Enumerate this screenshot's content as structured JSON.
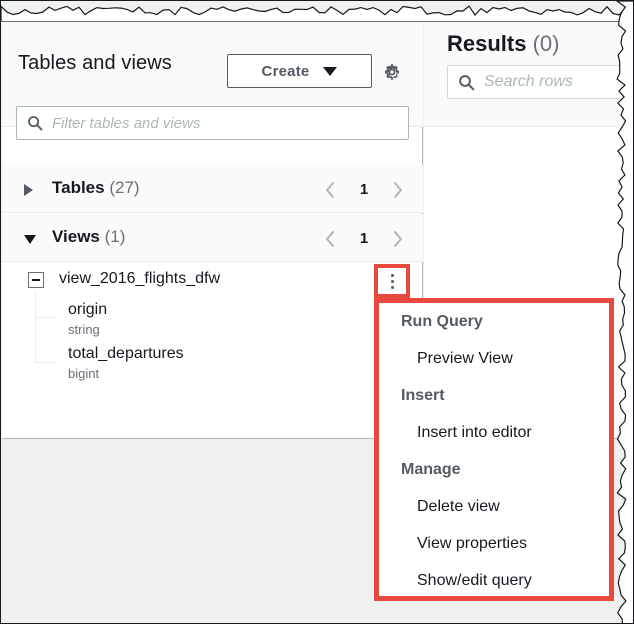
{
  "left_panel": {
    "title": "Tables and views",
    "create_button": {
      "label": "Create",
      "caret_icon": "caret-down-icon"
    },
    "settings_icon": "gear-icon",
    "filter": {
      "placeholder": "Filter tables and views",
      "value": "",
      "icon": "search-icon"
    },
    "groups": [
      {
        "name": "Tables",
        "count": "(27)",
        "expanded": false,
        "page": "1",
        "prev_icon": "chevron-left-icon",
        "next_icon": "chevron-right-icon"
      },
      {
        "name": "Views",
        "count": "(1)",
        "expanded": true,
        "page": "1",
        "prev_icon": "chevron-left-icon",
        "next_icon": "chevron-right-icon"
      }
    ],
    "tree": {
      "view": {
        "name": "view_2016_flights_dfw",
        "expand_icon": "minus-box-icon",
        "kebab_icon": "more-vertical-icon"
      },
      "columns": [
        {
          "name": "origin",
          "type": "string"
        },
        {
          "name": "total_departures",
          "type": "bigint"
        }
      ]
    }
  },
  "right_panel": {
    "title": "Results",
    "count": "(0)",
    "search": {
      "placeholder": "Search rows",
      "value": "",
      "icon": "search-icon"
    }
  },
  "context_menu": {
    "sections": [
      {
        "group": "Run Query",
        "items": [
          "Preview View"
        ]
      },
      {
        "group": "Insert",
        "items": [
          "Insert into editor"
        ]
      },
      {
        "group": "Manage",
        "items": [
          "Delete view",
          "View properties",
          "Show/edit query"
        ]
      }
    ]
  },
  "colors": {
    "highlight": "#e8493f",
    "panel_bg": "#ffffff",
    "header_bg": "#fafafa",
    "page_bg": "#eff0f0",
    "text": "#16191f",
    "muted": "#687078"
  }
}
